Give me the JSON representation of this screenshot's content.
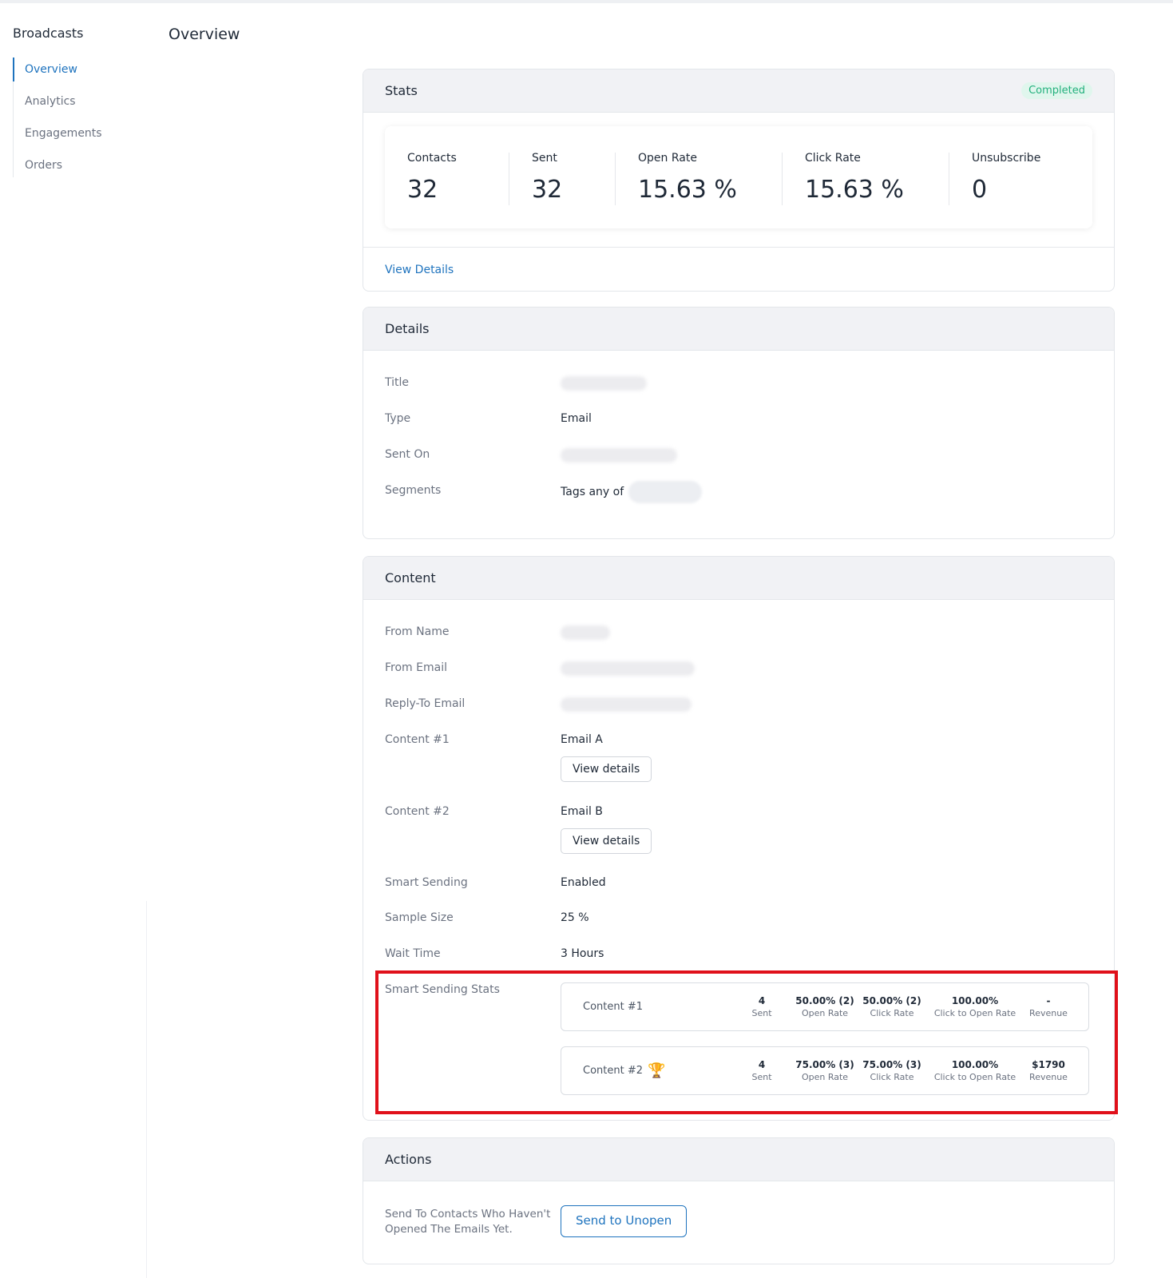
{
  "sidebar": {
    "title": "Broadcasts",
    "items": [
      {
        "label": "Overview",
        "active": true
      },
      {
        "label": "Analytics",
        "active": false
      },
      {
        "label": "Engagements",
        "active": false
      },
      {
        "label": "Orders",
        "active": false
      }
    ]
  },
  "page": {
    "title": "Overview"
  },
  "stats": {
    "title": "Stats",
    "status": "Completed",
    "metrics": [
      {
        "label": "Contacts",
        "value": "32"
      },
      {
        "label": "Sent",
        "value": "32"
      },
      {
        "label": "Open Rate",
        "value": "15.63 %"
      },
      {
        "label": "Click Rate",
        "value": "15.63 %"
      },
      {
        "label": "Unsubscribe",
        "value": "0"
      }
    ],
    "view_details": "View Details"
  },
  "details": {
    "title": "Details",
    "rows": {
      "title_label": "Title",
      "type_label": "Type",
      "type_value": "Email",
      "sent_on_label": "Sent On",
      "segments_label": "Segments",
      "segments_prefix": "Tags any of"
    }
  },
  "content": {
    "title": "Content",
    "from_name_label": "From Name",
    "from_email_label": "From Email",
    "reply_to_label": "Reply-To Email",
    "content1_label": "Content #1",
    "content1_value": "Email A",
    "content2_label": "Content #2",
    "content2_value": "Email B",
    "view_details_button": "View details",
    "smart_sending_label": "Smart Sending",
    "smart_sending_value": "Enabled",
    "sample_size_label": "Sample Size",
    "sample_size_value": "25 %",
    "wait_time_label": "Wait Time",
    "wait_time_value": "3 Hours",
    "smart_stats_label": "Smart Sending Stats",
    "smart_stats": [
      {
        "name": "Content #1",
        "winner": false,
        "sent": "4",
        "sent_label": "Sent",
        "open_rate": "50.00% (2)",
        "open_rate_label": "Open Rate",
        "click_rate": "50.00% (2)",
        "click_rate_label": "Click Rate",
        "cto_rate": "100.00%",
        "cto_rate_label": "Click to Open Rate",
        "revenue": "-",
        "revenue_label": "Revenue"
      },
      {
        "name": "Content #2",
        "winner": true,
        "sent": "4",
        "sent_label": "Sent",
        "open_rate": "75.00% (3)",
        "open_rate_label": "Open Rate",
        "click_rate": "75.00% (3)",
        "click_rate_label": "Click Rate",
        "cto_rate": "100.00%",
        "cto_rate_label": "Click to Open Rate",
        "revenue": "$1790",
        "revenue_label": "Revenue"
      }
    ]
  },
  "actions": {
    "title": "Actions",
    "description_line1": "Send To Contacts Who Haven't",
    "description_line2": "Opened The Emails Yet.",
    "button": "Send to Unopen"
  },
  "colors": {
    "accent": "#1e73be",
    "success": "#23b07d",
    "highlight": "#e0101a",
    "trophy": "#f0b323"
  },
  "icons": {
    "winner": "trophy-icon"
  }
}
